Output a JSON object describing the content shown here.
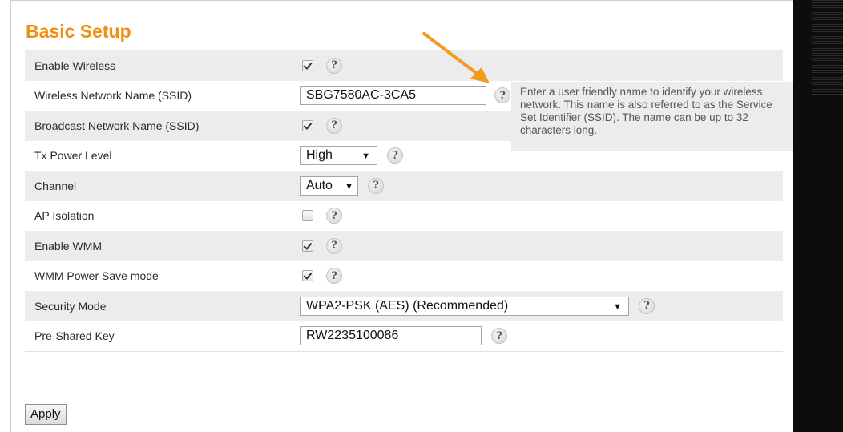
{
  "page": {
    "title": "Basic Setup",
    "accent_color": "#f08f14",
    "help_icon": "help-question-icon"
  },
  "settings": {
    "enable_wireless": {
      "label": "Enable Wireless",
      "checked": true
    },
    "ssid": {
      "label": "Wireless Network Name (SSID)",
      "value": "SBG7580AC-3CA5"
    },
    "broadcast_ssid": {
      "label": "Broadcast Network Name (SSID)",
      "checked": true
    },
    "tx_power": {
      "label": "Tx Power Level",
      "value": "High"
    },
    "channel": {
      "label": "Channel",
      "value": "Auto"
    },
    "ap_isolation": {
      "label": "AP Isolation",
      "checked": false
    },
    "enable_wmm": {
      "label": "Enable WMM",
      "checked": true
    },
    "wmm_power_save": {
      "label": "WMM Power Save mode",
      "checked": true
    },
    "security_mode": {
      "label": "Security Mode",
      "value": "WPA2-PSK (AES) (Recommended)"
    },
    "psk": {
      "label": "Pre-Shared Key",
      "value": "RW2235100086"
    }
  },
  "tooltip": {
    "text": "Enter a user friendly name to identify your wireless network. This name is also referred to as the Service Set Identifier (SSID). The name can be up to 32 characters long."
  },
  "help_glyph": "?",
  "dropdown_glyph": "▼",
  "annotation": {
    "arrow_color": "#f39a1f"
  },
  "actions": {
    "apply_label": "Apply"
  }
}
